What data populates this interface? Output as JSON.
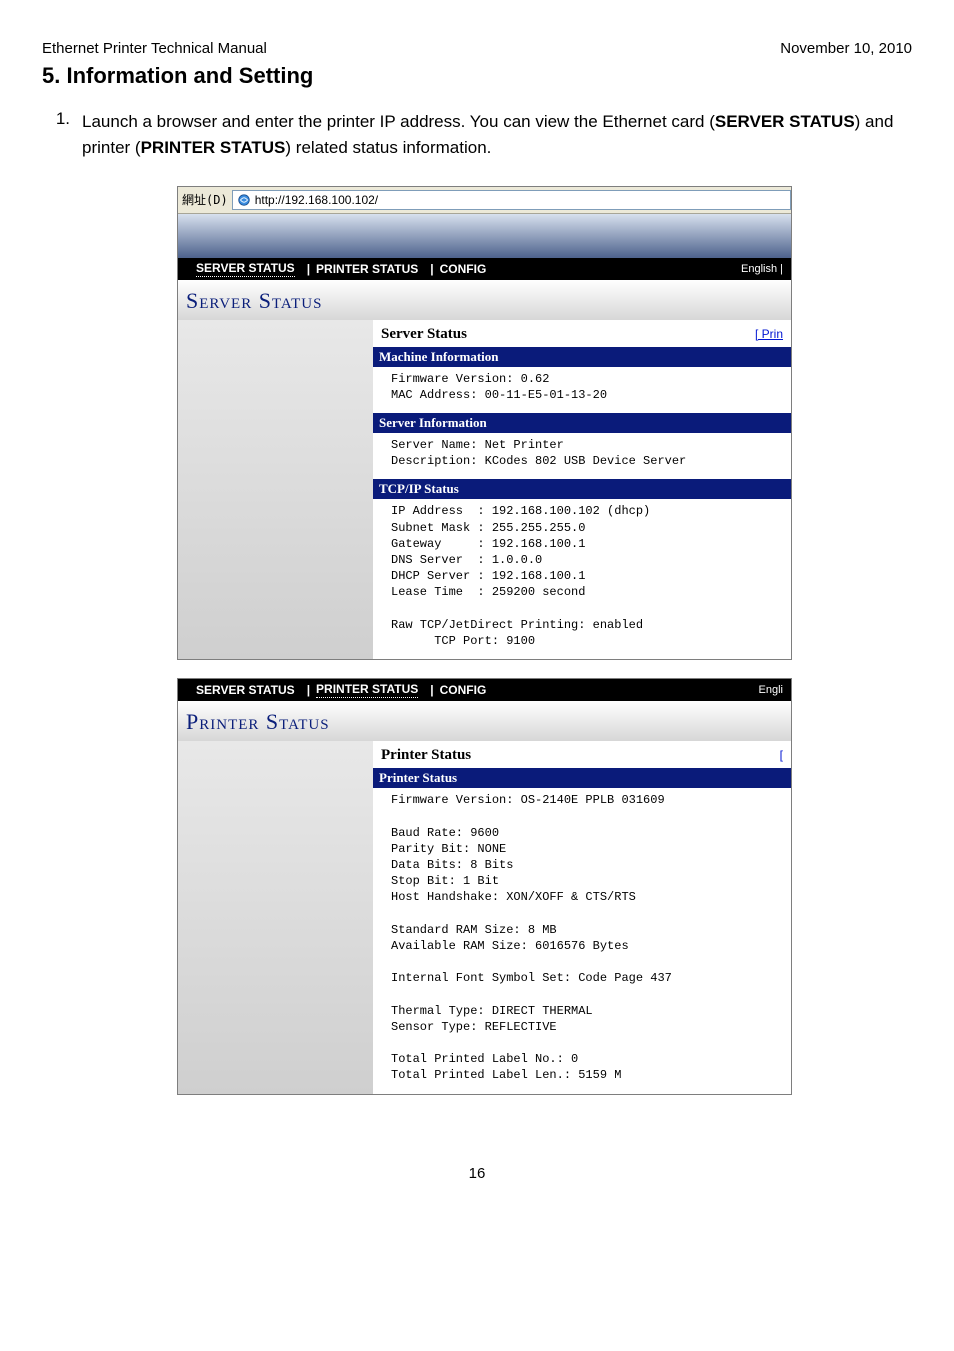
{
  "doc": {
    "header_left": "Ethernet Printer Technical Manual",
    "header_right": "November 10, 2010",
    "section_title": "5.  Information and Setting",
    "step_num": "1.",
    "step_text_1": "Launch a browser and enter the printer IP address. You can view the Ethernet card (",
    "step_text_bold1": "SERVER STATUS",
    "step_text_2": ") and printer (",
    "step_text_bold2": "PRINTER STATUS",
    "step_text_3": ") related status information.",
    "page_number": "16"
  },
  "shot1": {
    "addr_label": "網址(D)",
    "addr_url": "http://192.168.100.102/",
    "nav_items": [
      "SERVER STATUS",
      "PRINTER STATUS",
      "CONFIG"
    ],
    "nav_active_index": 0,
    "nav_lang": "English |",
    "big_title": "Server Status",
    "content_title": "Server Status",
    "print_link": "[ Prin",
    "sections": [
      {
        "head": "Machine Information",
        "body": "Firmware Version: 0.62\nMAC Address: 00-11-E5-01-13-20"
      },
      {
        "head": "Server Information",
        "body": "Server Name: Net Printer\nDescription: KCodes 802 USB Device Server"
      },
      {
        "head": "TCP/IP Status",
        "body": "IP Address  : 192.168.100.102 (dhcp)\nSubnet Mask : 255.255.255.0\nGateway     : 192.168.100.1\nDNS Server  : 1.0.0.0\nDHCP Server : 192.168.100.1\nLease Time  : 259200 second\n\nRaw TCP/JetDirect Printing: enabled\n      TCP Port: 9100"
      }
    ]
  },
  "shot2": {
    "nav_items": [
      "SERVER STATUS",
      "PRINTER STATUS",
      "CONFIG"
    ],
    "nav_active_index": 1,
    "nav_lang": "Engli",
    "big_title": "Printer Status",
    "content_title": "Printer Status",
    "print_link": "[",
    "sections": [
      {
        "head": "Printer Status",
        "body": "Firmware Version: OS-2140E PPLB 031609\n\nBaud Rate: 9600\nParity Bit: NONE\nData Bits: 8 Bits\nStop Bit: 1 Bit\nHost Handshake: XON/XOFF & CTS/RTS\n\nStandard RAM Size: 8 MB\nAvailable RAM Size: 6016576 Bytes\n\nInternal Font Symbol Set: Code Page 437\n\nThermal Type: DIRECT THERMAL\nSensor Type: REFLECTIVE\n\nTotal Printed Label No.: 0\nTotal Printed Label Len.: 5159 M"
      }
    ]
  }
}
